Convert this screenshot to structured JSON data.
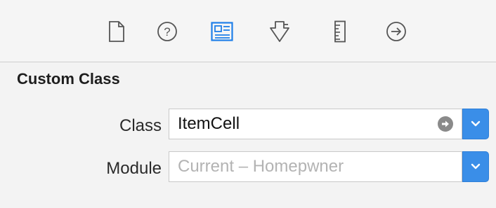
{
  "toolbar": {
    "icons": [
      {
        "name": "file-inspector-icon",
        "selected": false
      },
      {
        "name": "quick-help-icon",
        "selected": false
      },
      {
        "name": "identity-inspector-icon",
        "selected": true
      },
      {
        "name": "attributes-inspector-icon",
        "selected": false
      },
      {
        "name": "size-inspector-icon",
        "selected": false
      },
      {
        "name": "connections-inspector-icon",
        "selected": false
      }
    ],
    "accent_color": "#1f7fe8"
  },
  "custom_class": {
    "title": "Custom Class",
    "class_label": "Class",
    "class_value": "ItemCell",
    "module_label": "Module",
    "module_placeholder": "Current – Homepwner"
  }
}
